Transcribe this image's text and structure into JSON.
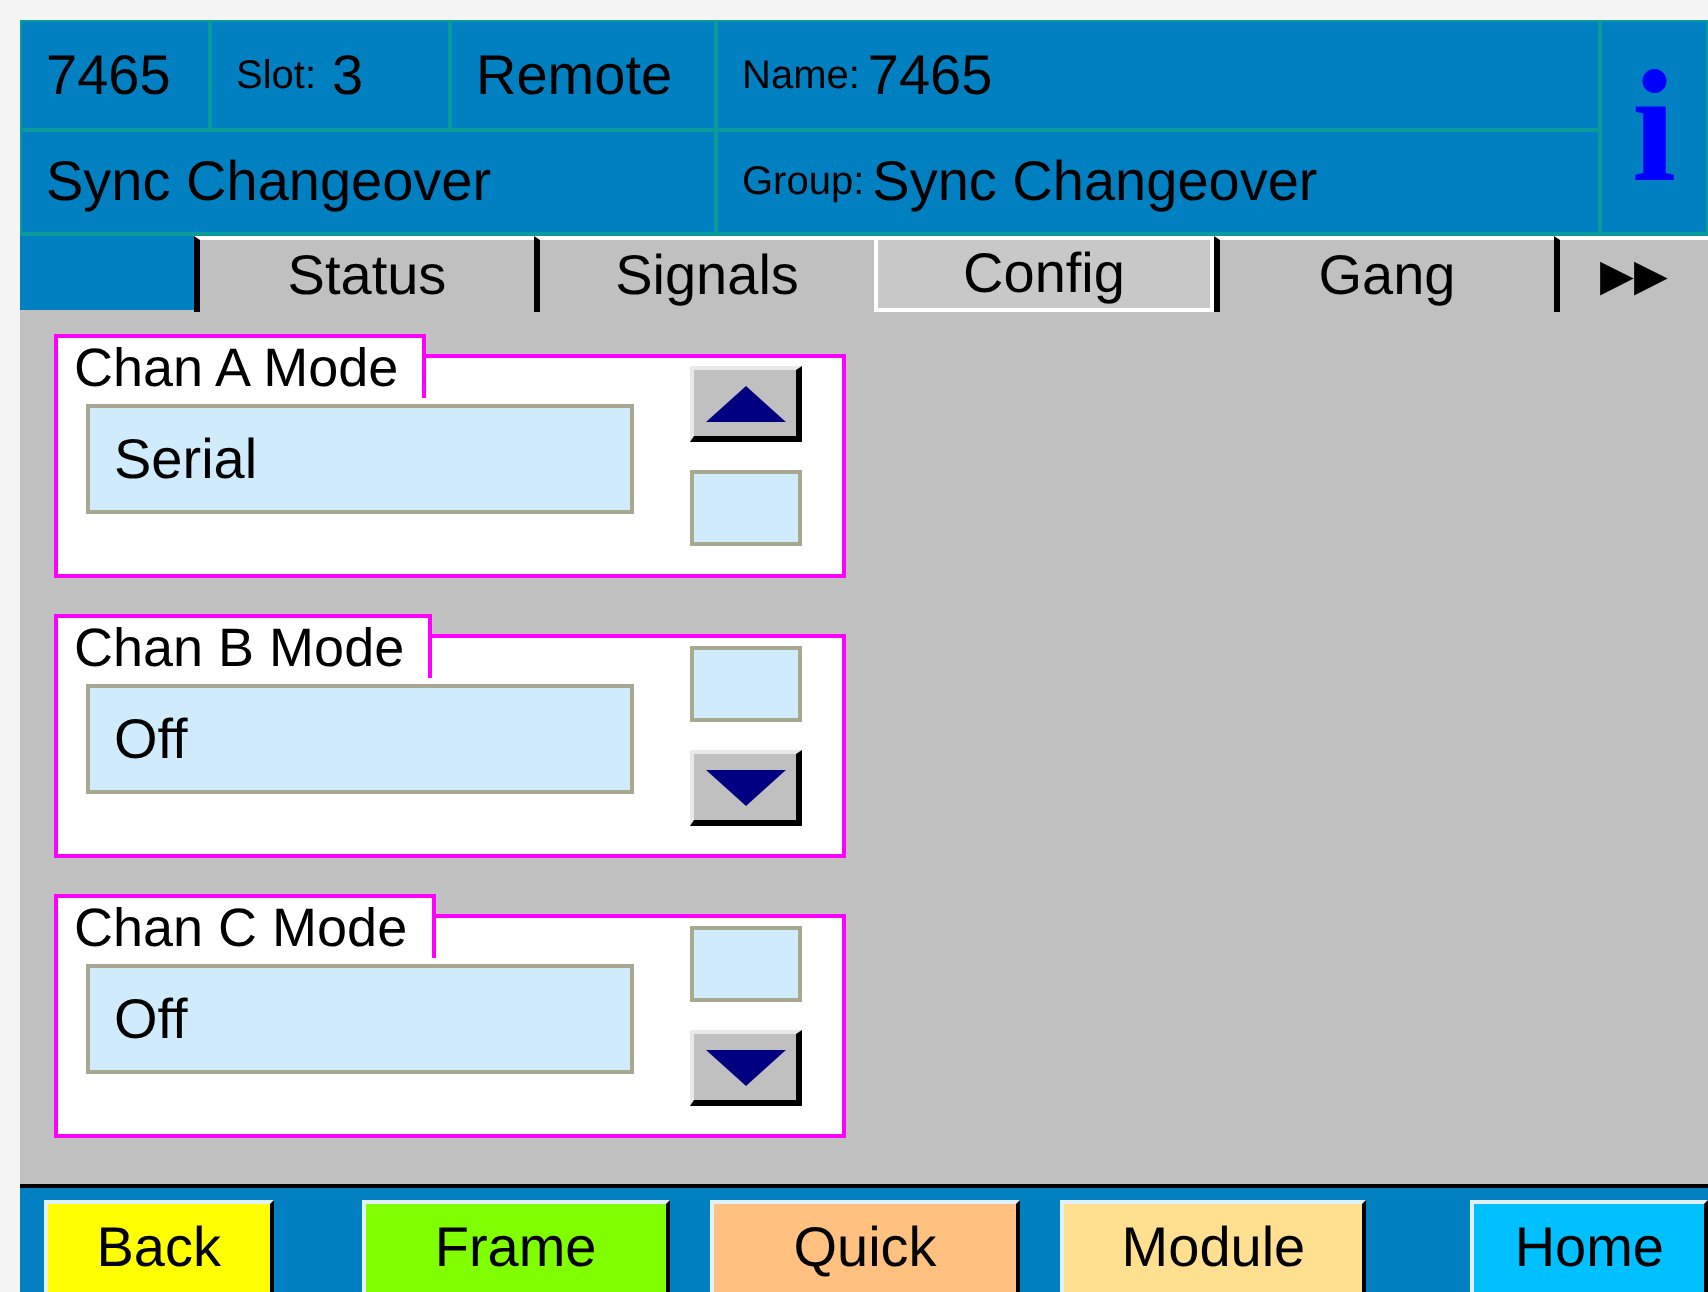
{
  "header": {
    "id": "7465",
    "slot_label": "Slot:",
    "slot": "3",
    "mode": "Remote",
    "name_label": "Name:",
    "name": "7465",
    "module": "Sync Changeover",
    "group_label": "Group:",
    "group": "Sync Changeover",
    "info": "i"
  },
  "tabs": [
    {
      "label": "Status",
      "selected": false
    },
    {
      "label": "Signals",
      "selected": false
    },
    {
      "label": "Config",
      "selected": true
    },
    {
      "label": "Gang",
      "selected": false
    },
    {
      "label": "▶▶",
      "selected": false
    }
  ],
  "channels": [
    {
      "label": "Chan A Mode",
      "value": "Serial",
      "buttons": [
        {
          "kind": "up"
        },
        {
          "kind": "blank"
        }
      ]
    },
    {
      "label": "Chan B Mode",
      "value": "Off",
      "buttons": [
        {
          "kind": "blank"
        },
        {
          "kind": "down"
        }
      ]
    },
    {
      "label": "Chan C Mode",
      "value": "Off",
      "buttons": [
        {
          "kind": "blank"
        },
        {
          "kind": "down"
        }
      ]
    }
  ],
  "footer": [
    {
      "label": "Back",
      "color": "#ffff00"
    },
    {
      "label": "Frame",
      "color": "#80ff00"
    },
    {
      "label": "Quick",
      "color": "#ffc080"
    },
    {
      "label": "Module",
      "color": "#ffe090"
    },
    {
      "label": "Home",
      "color": "#00c0ff"
    }
  ]
}
